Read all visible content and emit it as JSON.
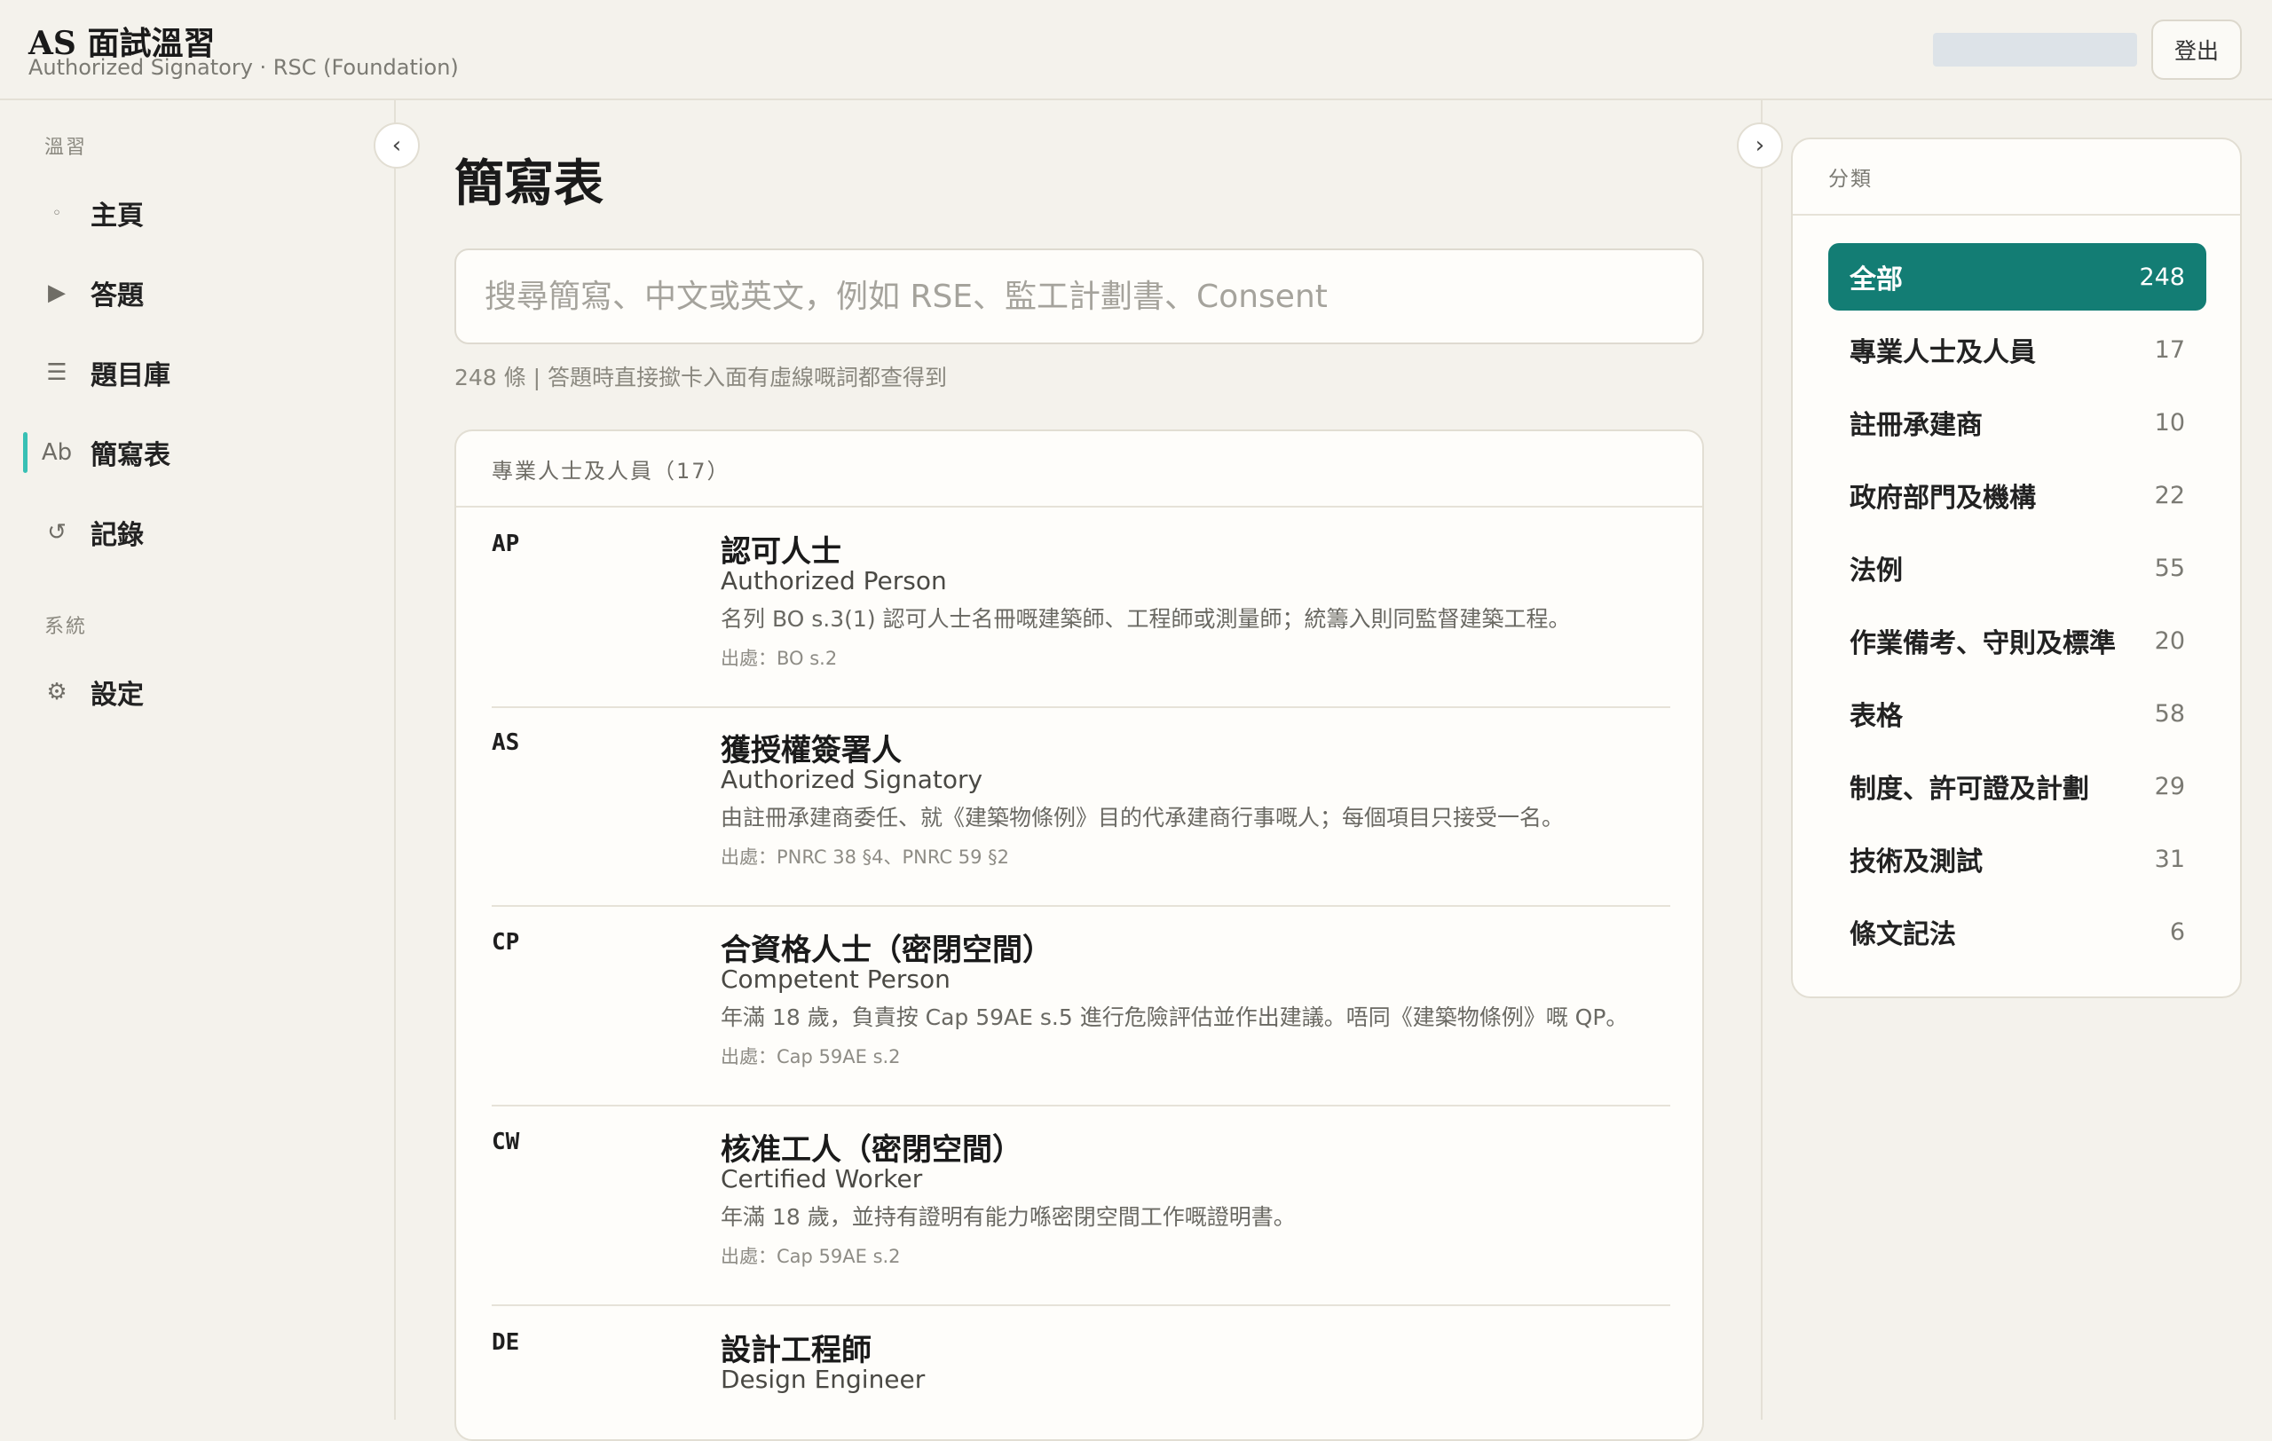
{
  "header": {
    "title": "AS 面試溫習",
    "subtitle": "Authorized Signatory · RSC (Foundation)",
    "logout_label": "登出"
  },
  "sidebar": {
    "section_study": "溫習",
    "section_system": "系統",
    "items": [
      {
        "icon": "dot-icon",
        "glyph": "◦",
        "label": "主頁"
      },
      {
        "icon": "play-icon",
        "glyph": "▶",
        "label": "答題"
      },
      {
        "icon": "list-icon",
        "glyph": "☰",
        "label": "題目庫"
      },
      {
        "icon": "abbr-icon",
        "glyph": "Ab",
        "label": "簡寫表"
      },
      {
        "icon": "history-icon",
        "glyph": "↺",
        "label": "記錄"
      }
    ],
    "settings": {
      "icon": "gear-icon",
      "glyph": "⚙",
      "label": "設定"
    },
    "collapse_glyph": "‹"
  },
  "main": {
    "title": "簡寫表",
    "search_placeholder": "搜尋簡寫、中文或英文，例如 RSE、監工計劃書、Consent",
    "count_line": "248 條 | 答題時直接撳卡入面有虛線嘅詞都查得到",
    "group_header": "專業人士及人員（17）",
    "entries": [
      {
        "abbr": "AP",
        "zh": "認可人士",
        "en": "Authorized Person",
        "desc": "名列 BO s.3(1) 認可人士名冊嘅建築師、工程師或測量師；統籌入則同監督建築工程。",
        "src": "出處：BO s.2"
      },
      {
        "abbr": "AS",
        "zh": "獲授權簽署人",
        "en": "Authorized Signatory",
        "desc": "由註冊承建商委任、就《建築物條例》目的代承建商行事嘅人；每個項目只接受一名。",
        "src": "出處：PNRC 38 §4、PNRC 59 §2"
      },
      {
        "abbr": "CP",
        "zh": "合資格人士（密閉空間）",
        "en": "Competent Person",
        "desc": "年滿 18 歲，負責按 Cap 59AE s.5 進行危險評估並作出建議。唔同《建築物條例》嘅 QP。",
        "src": "出處：Cap 59AE s.2"
      },
      {
        "abbr": "CW",
        "zh": "核准工人（密閉空間）",
        "en": "Certified Worker",
        "desc": "年滿 18 歲，並持有證明有能力喺密閉空間工作嘅證明書。",
        "src": "出處：Cap 59AE s.2"
      },
      {
        "abbr": "DE",
        "zh": "設計工程師",
        "en": "Design Engineer",
        "desc": "",
        "src": ""
      }
    ]
  },
  "right_panel": {
    "collapse_glyph": "›",
    "header": "分類",
    "categories": [
      {
        "label": "全部",
        "count": "248"
      },
      {
        "label": "專業人士及人員",
        "count": "17"
      },
      {
        "label": "註冊承建商",
        "count": "10"
      },
      {
        "label": "政府部門及機構",
        "count": "22"
      },
      {
        "label": "法例",
        "count": "55"
      },
      {
        "label": "作業備考、守則及標準",
        "count": "20"
      },
      {
        "label": "表格",
        "count": "58"
      },
      {
        "label": "制度、許可證及計劃",
        "count": "29"
      },
      {
        "label": "技術及測試",
        "count": "31"
      },
      {
        "label": "條文記法",
        "count": "6"
      }
    ]
  },
  "colors": {
    "accent": "#137d74",
    "active_indicator": "#38c0b4",
    "background": "#f4f2ec"
  }
}
